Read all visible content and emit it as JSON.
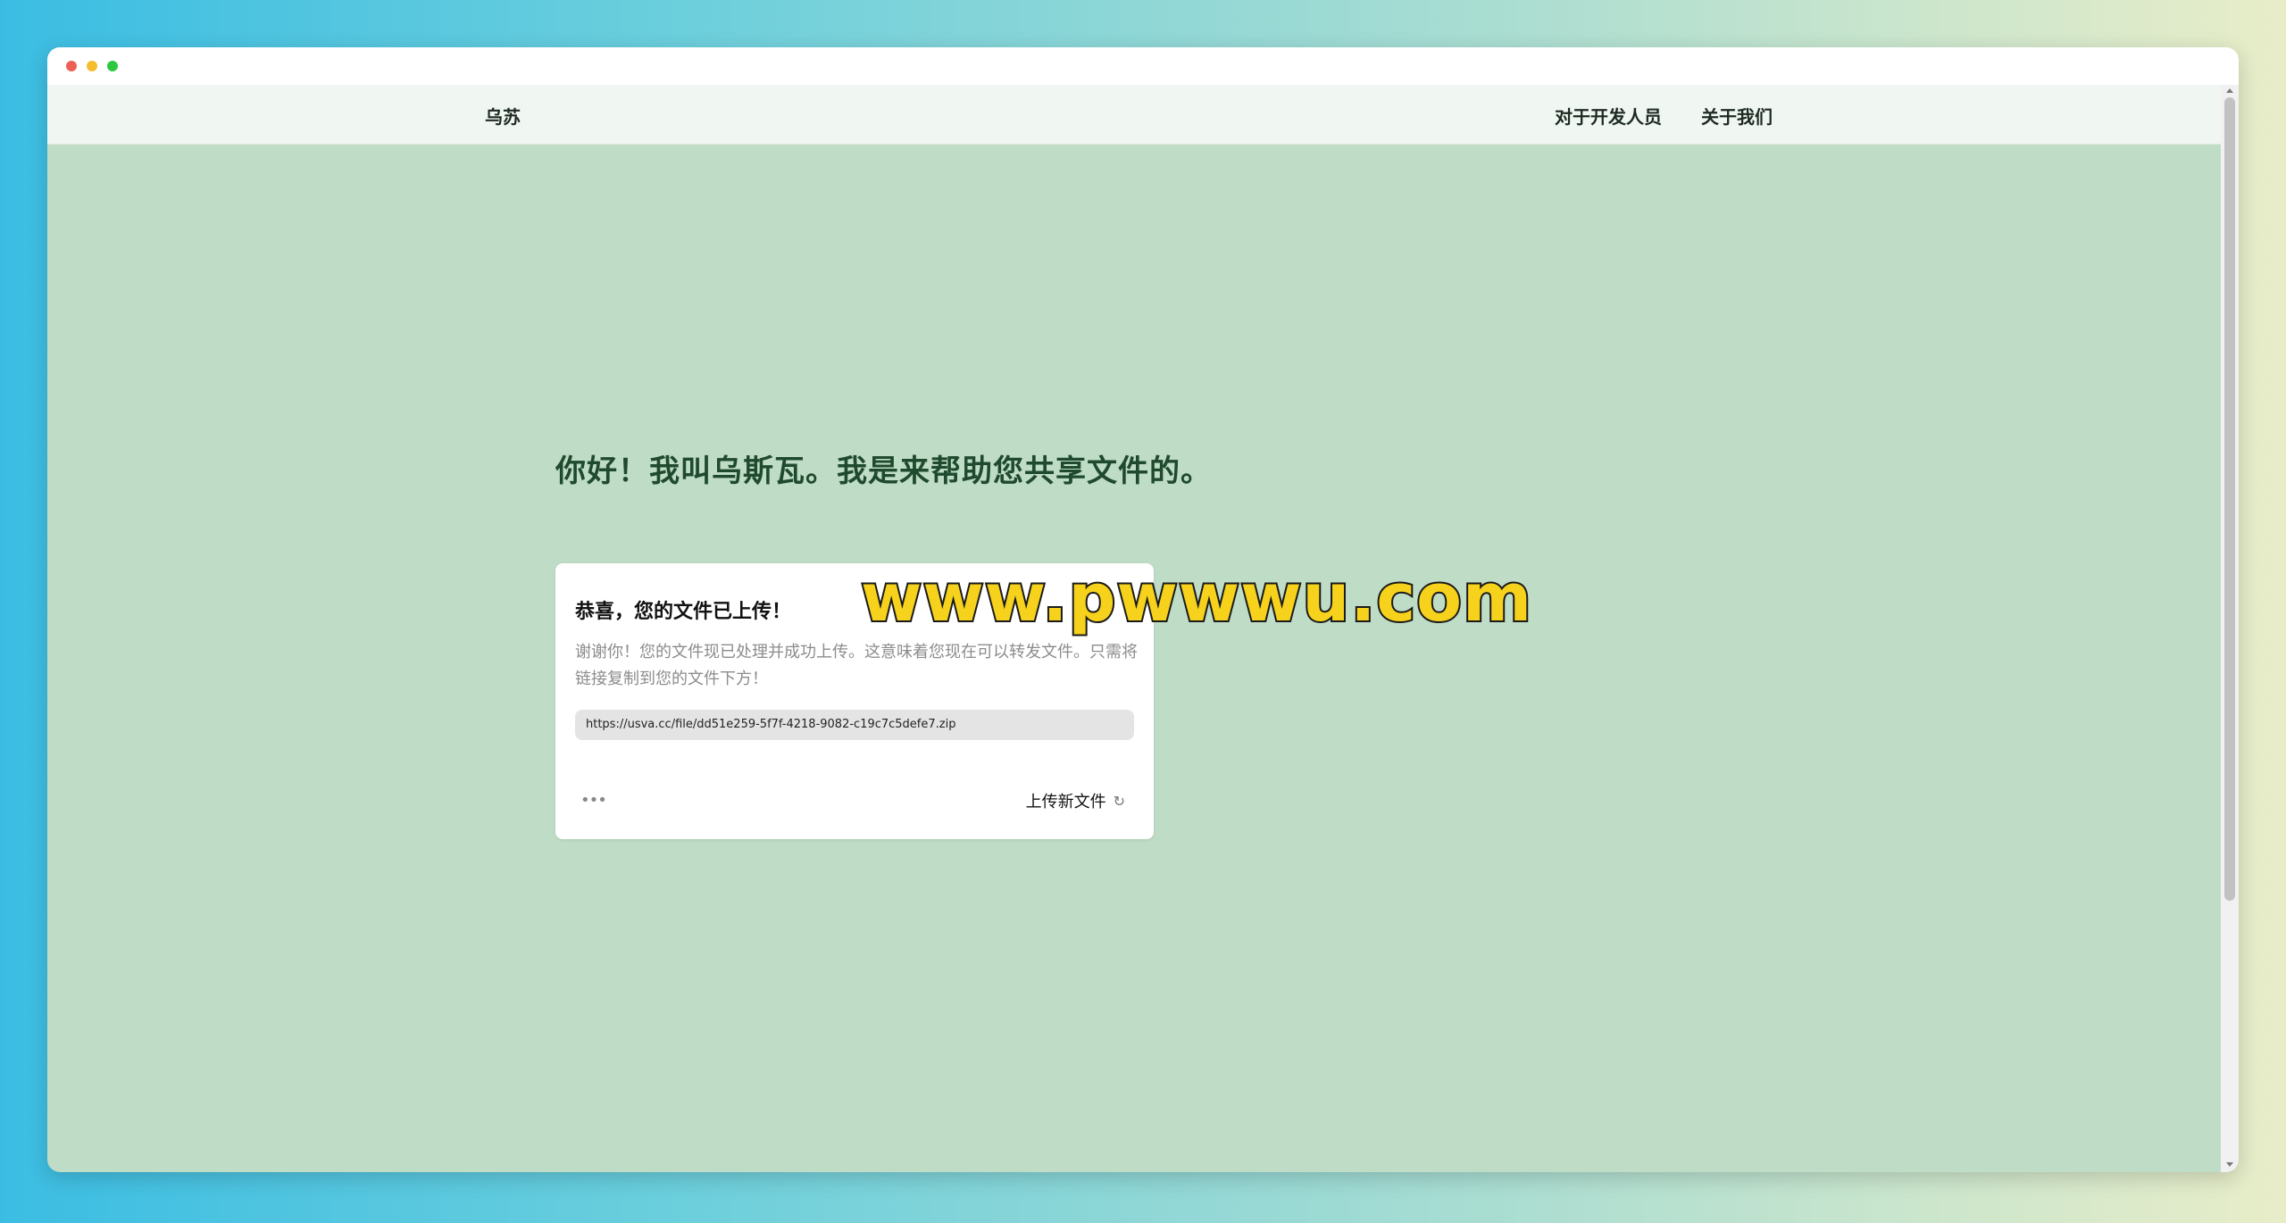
{
  "navbar": {
    "brand": "乌苏",
    "links": [
      {
        "label": "对于开发人员"
      },
      {
        "label": "关于我们"
      }
    ]
  },
  "hero": {
    "heading": "你好！我叫乌斯瓦。我是来帮助您共享文件的。"
  },
  "card": {
    "title": "恭喜，您的文件已上传！",
    "description": "谢谢你！您的文件现已处理并成功上传。这意味着您现在可以转发文件。只需将链接复制到您的文件下方！",
    "link_value": "https://usva.cc/file/dd51e259-5f7f-4218-9082-c19c7c5defe7.zip",
    "more_label": "•••",
    "upload_new_label": "上传新文件",
    "refresh_glyph": "↻"
  },
  "watermark": {
    "text": "www.pwwwu.com"
  },
  "colors": {
    "page_bg": "#bfdcc6",
    "navbar_bg": "#f0f6f1",
    "heading": "#1f4a2e",
    "watermark_fill": "#f6d21c"
  }
}
